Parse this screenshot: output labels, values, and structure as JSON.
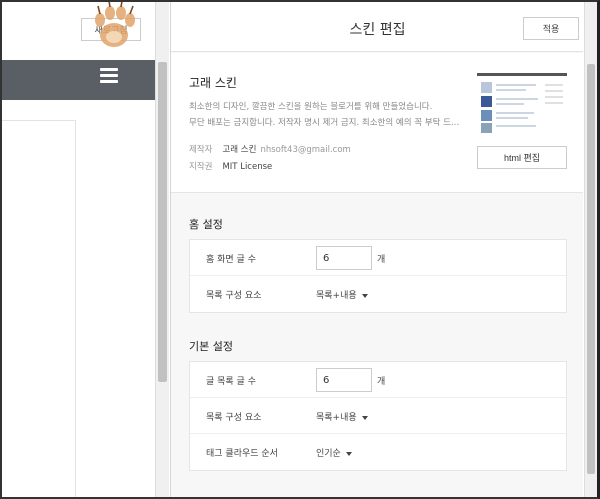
{
  "preview": {
    "refresh_label": "새로고침",
    "collapse_glyph": "›"
  },
  "editor": {
    "title": "스킨 편집",
    "apply_label": "적용",
    "skin": {
      "name": "고래 스킨",
      "description_line1": "최소한의 디자인, 깔끔한 스킨을 원하는 블로거를 위해 만들었습니다.",
      "description_line2": "무단 배포는 금지합니다. 저작자 명시 제거 금지. 최소한의 예의 꼭 부탁 드…",
      "maker_label": "제작자",
      "maker_value": "고래 스킨",
      "maker_email": "nhsoft43@gmail.com",
      "license_label": "지작권",
      "license_value": "MIT License",
      "html_edit_label": "html 편집"
    },
    "home_settings": {
      "title": "홈 설정",
      "rows": [
        {
          "label": "홈 화면 글 수",
          "value": "6",
          "unit": "개"
        },
        {
          "label": "목록 구성 요소",
          "select": "목록+내용"
        }
      ]
    },
    "basic_settings": {
      "title": "기본 설정",
      "rows": [
        {
          "label": "글 목록 글 수",
          "value": "6",
          "unit": "개"
        },
        {
          "label": "목록 구성 요소",
          "select": "목록+내용"
        },
        {
          "label": "태그 클라우드 순서",
          "select": "인기순"
        }
      ]
    }
  },
  "colors": {
    "preview_bar": "#5a5f66",
    "editor_bg": "#f7f7f8",
    "accent_thumb_border": "#555555"
  }
}
